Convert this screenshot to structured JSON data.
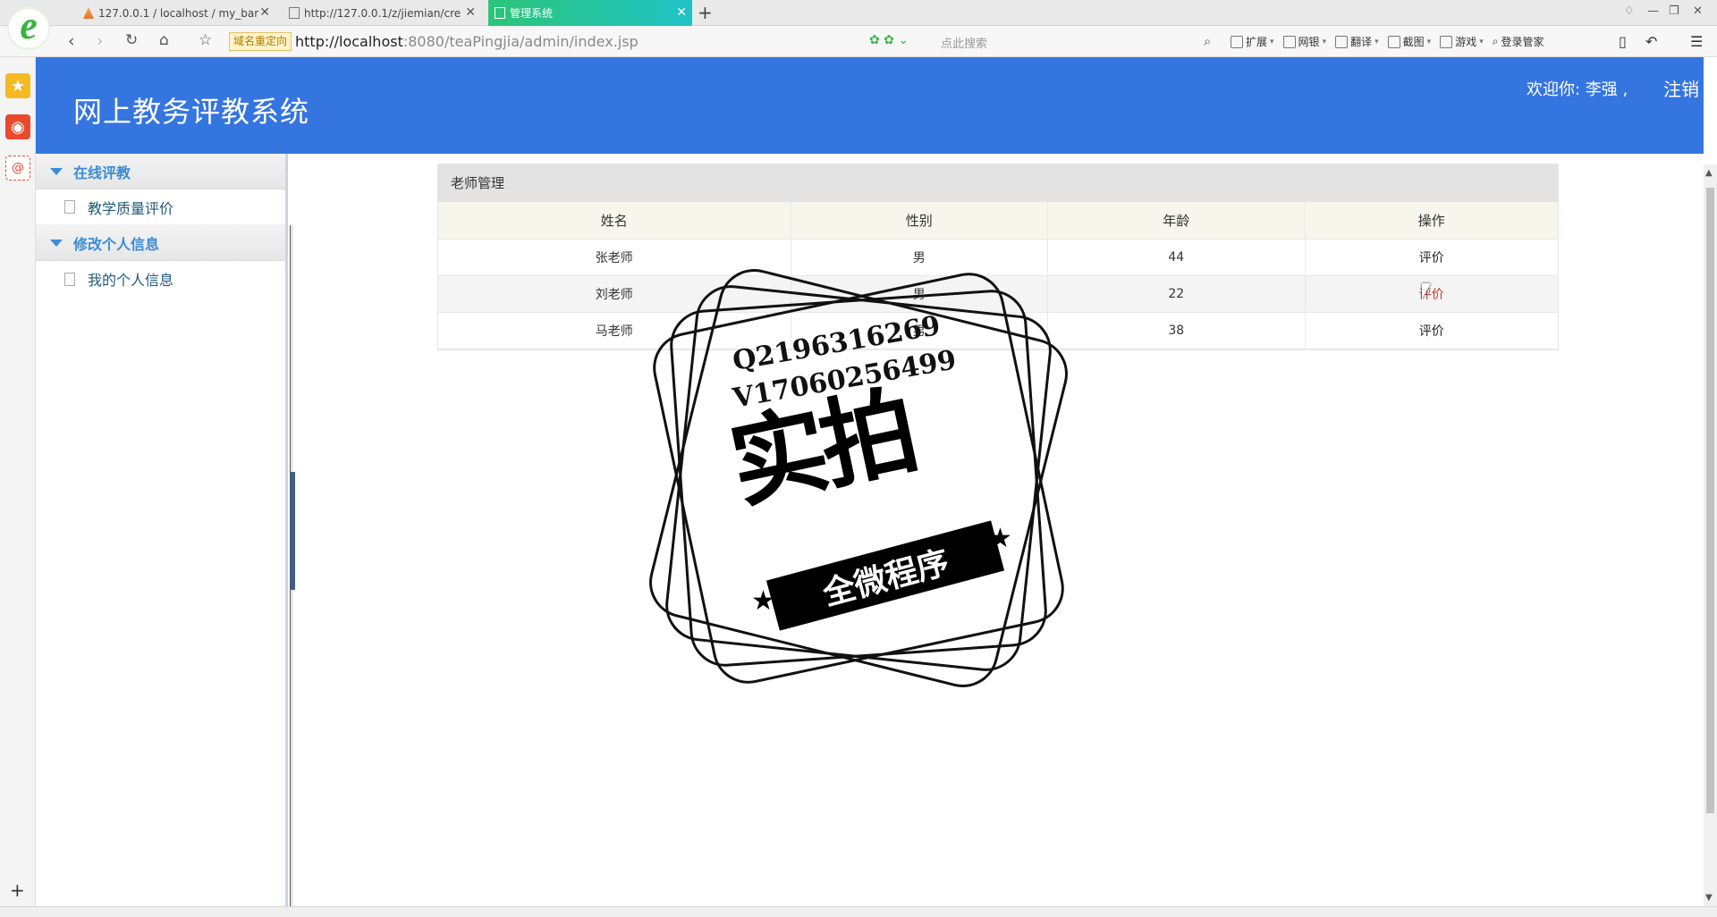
{
  "browser": {
    "tabs": [
      {
        "title": "127.0.0.1 / localhost / my_bar",
        "favicon": "phpmyadmin-icon",
        "active": false
      },
      {
        "title": "http://127.0.0.1/z/jiemian/cre",
        "favicon": "page-icon",
        "active": false
      },
      {
        "title": "管理系统",
        "favicon": "page-icon",
        "active": true
      }
    ],
    "redirect_badge": "域名重定向",
    "url_host": "http://localhost",
    "url_path": ":8080/teaPingjia/admin/index.jsp",
    "search_placeholder": "点此搜索",
    "toolbar": [
      "扩展",
      "网银",
      "翻译",
      "截图",
      "游戏"
    ],
    "account": "登录管家",
    "accent": "#2cc477"
  },
  "app": {
    "title": "网上教务评教系统",
    "welcome": "欢迎你: 李强 ,",
    "logout": "注销",
    "header_color": "#3575e0"
  },
  "menu": {
    "groups": [
      {
        "label": "在线评教",
        "items": [
          "教学质量评价"
        ]
      },
      {
        "label": "修改个人信息",
        "items": [
          "我的个人信息"
        ]
      }
    ]
  },
  "panel": {
    "title": "老师管理",
    "columns": [
      "姓名",
      "性别",
      "年龄",
      "操作"
    ],
    "rows": [
      {
        "name": "张老师",
        "gender": "男",
        "age": "44",
        "action": "评价"
      },
      {
        "name": "刘老师",
        "gender": "男",
        "age": "22",
        "action": "评价"
      },
      {
        "name": "马老师",
        "gender": "男",
        "age": "38",
        "action": "评价"
      }
    ]
  },
  "watermark": {
    "line1": "Q2196316269",
    "line2": "V17060256499",
    "big": "实拍",
    "ribbon": "全微程序"
  }
}
